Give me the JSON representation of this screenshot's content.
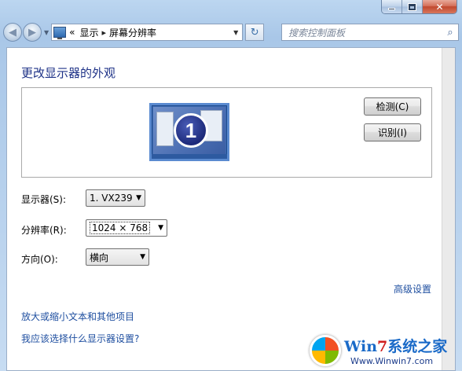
{
  "window": {
    "minimize_icon": "minimize-icon",
    "maximize_icon": "maximize-icon",
    "close_icon": "close-icon",
    "close_glyph": "✕"
  },
  "nav": {
    "back_glyph": "◀",
    "forward_glyph": "▶",
    "history_glyph": "▼",
    "breadcrumb_prefix": "«",
    "breadcrumb": [
      "显示",
      "屏幕分辨率"
    ],
    "breadcrumb_sep": "▸",
    "address_dropdown_glyph": "▼",
    "refresh_glyph": "↻",
    "search_placeholder": "搜索控制面板",
    "search_glyph": "⌕"
  },
  "page": {
    "title": "更改显示器的外观",
    "monitor_number": "1",
    "detect_button": "检测(C)",
    "identify_button": "识别(I)"
  },
  "settings": {
    "display_label": "显示器(S):",
    "display_value": "1. VX239",
    "resolution_label": "分辨率(R):",
    "resolution_value": "1024 × 768",
    "orientation_label": "方向(O):",
    "orientation_value": "横向",
    "dropdown_glyph": "▼"
  },
  "links": {
    "advanced": "高级设置",
    "text_size": "放大或缩小文本和其他项目",
    "which_settings": "我应该选择什么显示器设置?"
  },
  "watermark": {
    "brand_a": "Win",
    "brand_b": "7",
    "brand_c": "系统之家",
    "url": "Www.Winwin7.com"
  }
}
